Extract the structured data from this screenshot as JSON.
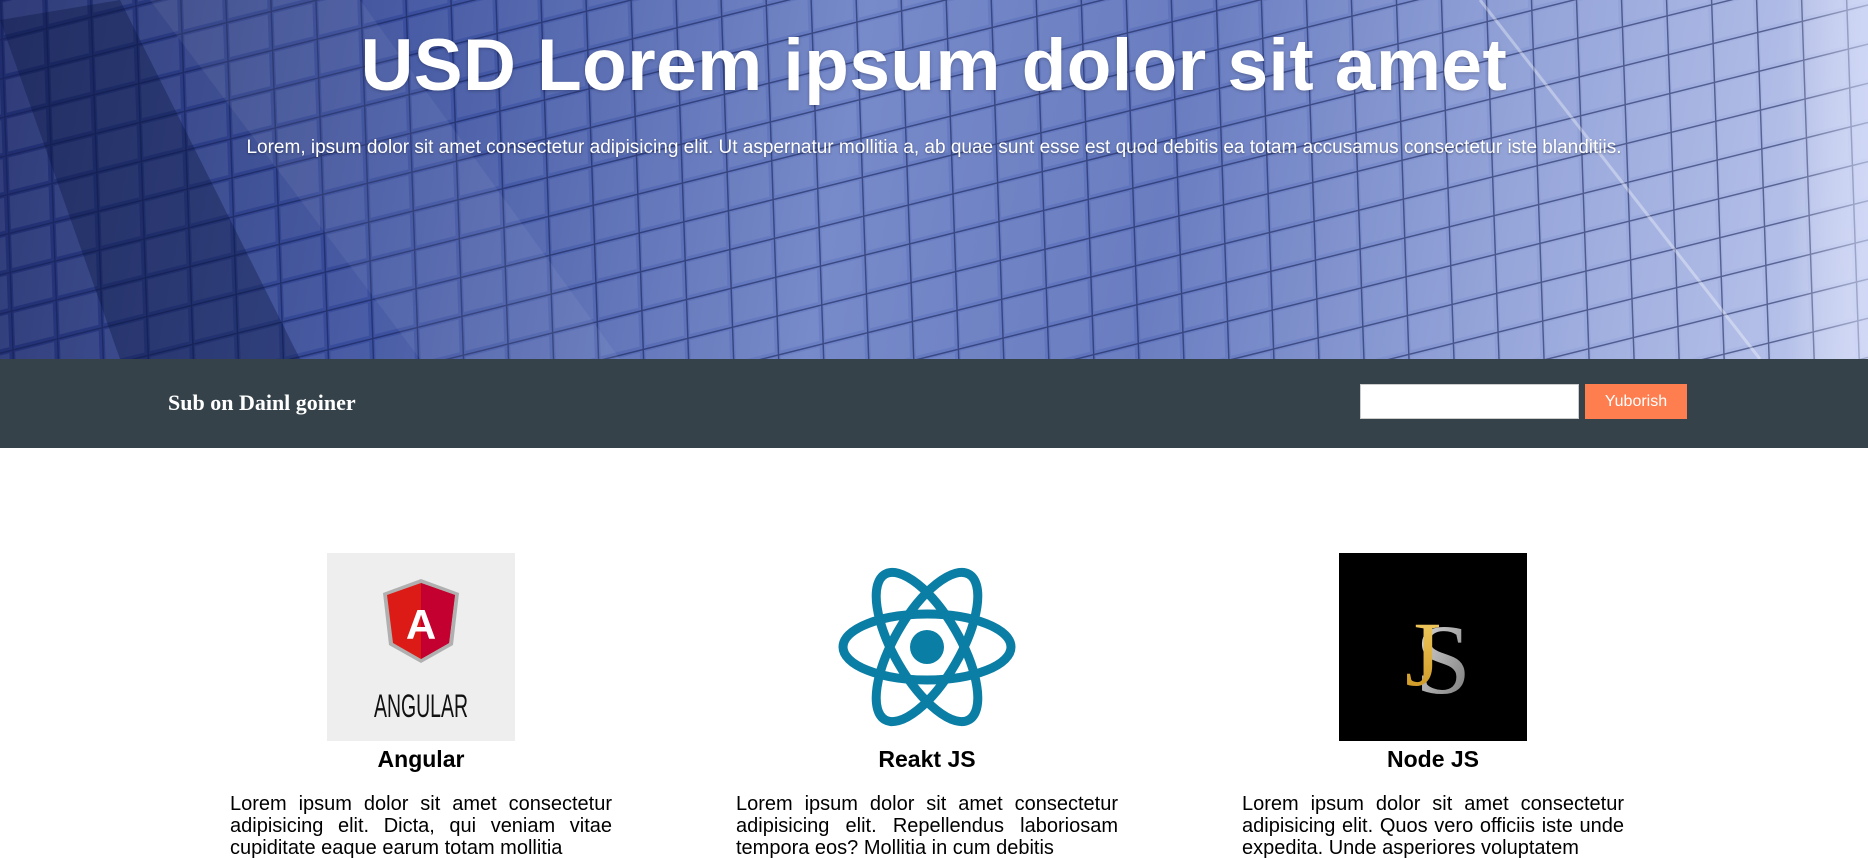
{
  "hero": {
    "title": "USD Lorem ipsum dolor sit amet",
    "subtitle": "Lorem, ipsum dolor sit amet consectetur adipisicing elit. Ut aspernatur mollitia a, ab quae sunt esse est quod debitis ea totam accusamus consectetur iste blanditiis."
  },
  "subscribe": {
    "label": "Sub on Dainl goiner",
    "input_value": "",
    "input_placeholder": "",
    "button_label": "Yuborish"
  },
  "cards": [
    {
      "icon": "angular-logo-icon",
      "logo_text": "ANGULAR",
      "logo_letter": "A",
      "title": "Angular",
      "text": "Lorem ipsum dolor sit amet consectetur adipisicing elit. Dicta, qui veniam vitae cupiditate eaque earum totam mollitia"
    },
    {
      "icon": "react-logo-icon",
      "title": "Reakt JS",
      "text": "Lorem ipsum dolor sit amet consectetur adipisicing elit. Repellendus laboriosam tempora eos? Mollitia in cum debitis"
    },
    {
      "icon": "js-logo-icon",
      "logo_text": "JS",
      "title": "Node JS",
      "text": "Lorem ipsum dolor sit amet consectetur adipisicing elit. Quos vero officiis iste unde expedita. Unde asperiores voluptatem"
    }
  ],
  "colors": {
    "bar": "#35424a",
    "button": "#ff7e4f",
    "react": "#0a7ea4",
    "angular": "#dd1b16"
  }
}
